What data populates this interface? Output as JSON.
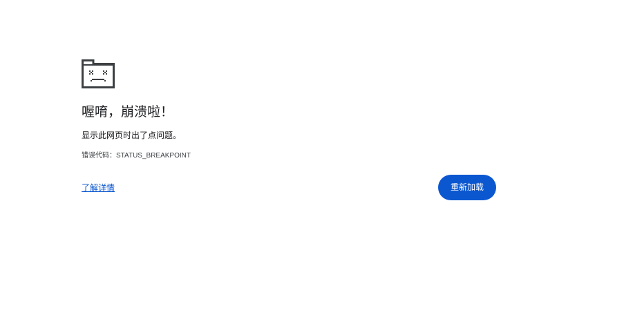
{
  "error_page": {
    "icon": "sad-tab-icon",
    "heading": "喔唷，崩溃啦！",
    "message": "显示此网页时出了点问题。",
    "error_code_label": "错误代码：",
    "error_code_value": "STATUS_BREAKPOINT",
    "learn_more_link": "了解详情",
    "reload_button": "重新加载"
  },
  "colors": {
    "background": "#ffffff",
    "text": "#202124",
    "link": "#0b57d0",
    "button": "#0b57d0",
    "button_text": "#ffffff"
  }
}
